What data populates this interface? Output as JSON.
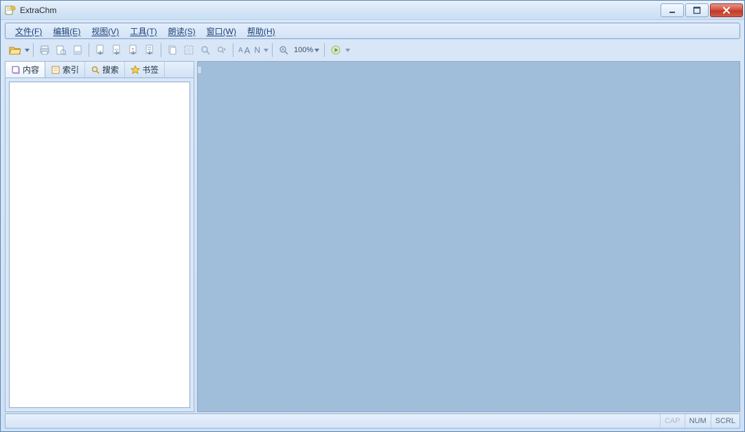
{
  "window": {
    "title": "ExtraChm"
  },
  "menu": {
    "items": [
      "文件(F)",
      "编辑(E)",
      "视图(V)",
      "工具(T)",
      "朗读(S)",
      "窗口(W)",
      "帮助(H)"
    ]
  },
  "toolbar": {
    "zoom_label": "100%",
    "font_letter": "N"
  },
  "sidebar": {
    "tabs": [
      {
        "label": "内容",
        "icon": "book-icon"
      },
      {
        "label": "索引",
        "icon": "index-icon"
      },
      {
        "label": "搜索",
        "icon": "search-icon"
      },
      {
        "label": "书签",
        "icon": "star-icon"
      }
    ]
  },
  "statusbar": {
    "cap": "CAP",
    "num": "NUM",
    "scrl": "SCRL"
  }
}
